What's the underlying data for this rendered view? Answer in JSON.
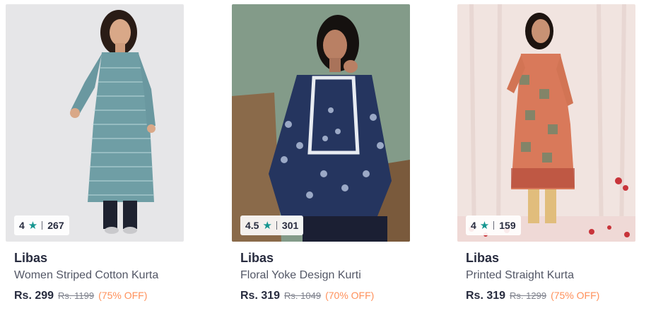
{
  "products": [
    {
      "rating": "4",
      "rating_count": "267",
      "brand": "Libas",
      "title": "Women Striped Cotton Kurta",
      "price": "Rs. 299",
      "mrp": "Rs. 1199",
      "discount": "(75% OFF)"
    },
    {
      "rating": "4.5",
      "rating_count": "301",
      "brand": "Libas",
      "title": "Floral Yoke Design Kurti",
      "price": "Rs. 319",
      "mrp": "Rs. 1049",
      "discount": "(70% OFF)"
    },
    {
      "rating": "4",
      "rating_count": "159",
      "brand": "Libas",
      "title": "Printed Straight Kurta",
      "price": "Rs. 319",
      "mrp": "Rs. 1299",
      "discount": "(75% OFF)"
    }
  ],
  "colors": {
    "star": "#14958f",
    "discount": "#ff905a",
    "brand_text": "#282c3f",
    "title_text": "#535766"
  },
  "icons": {
    "rating_star": "star-icon"
  }
}
